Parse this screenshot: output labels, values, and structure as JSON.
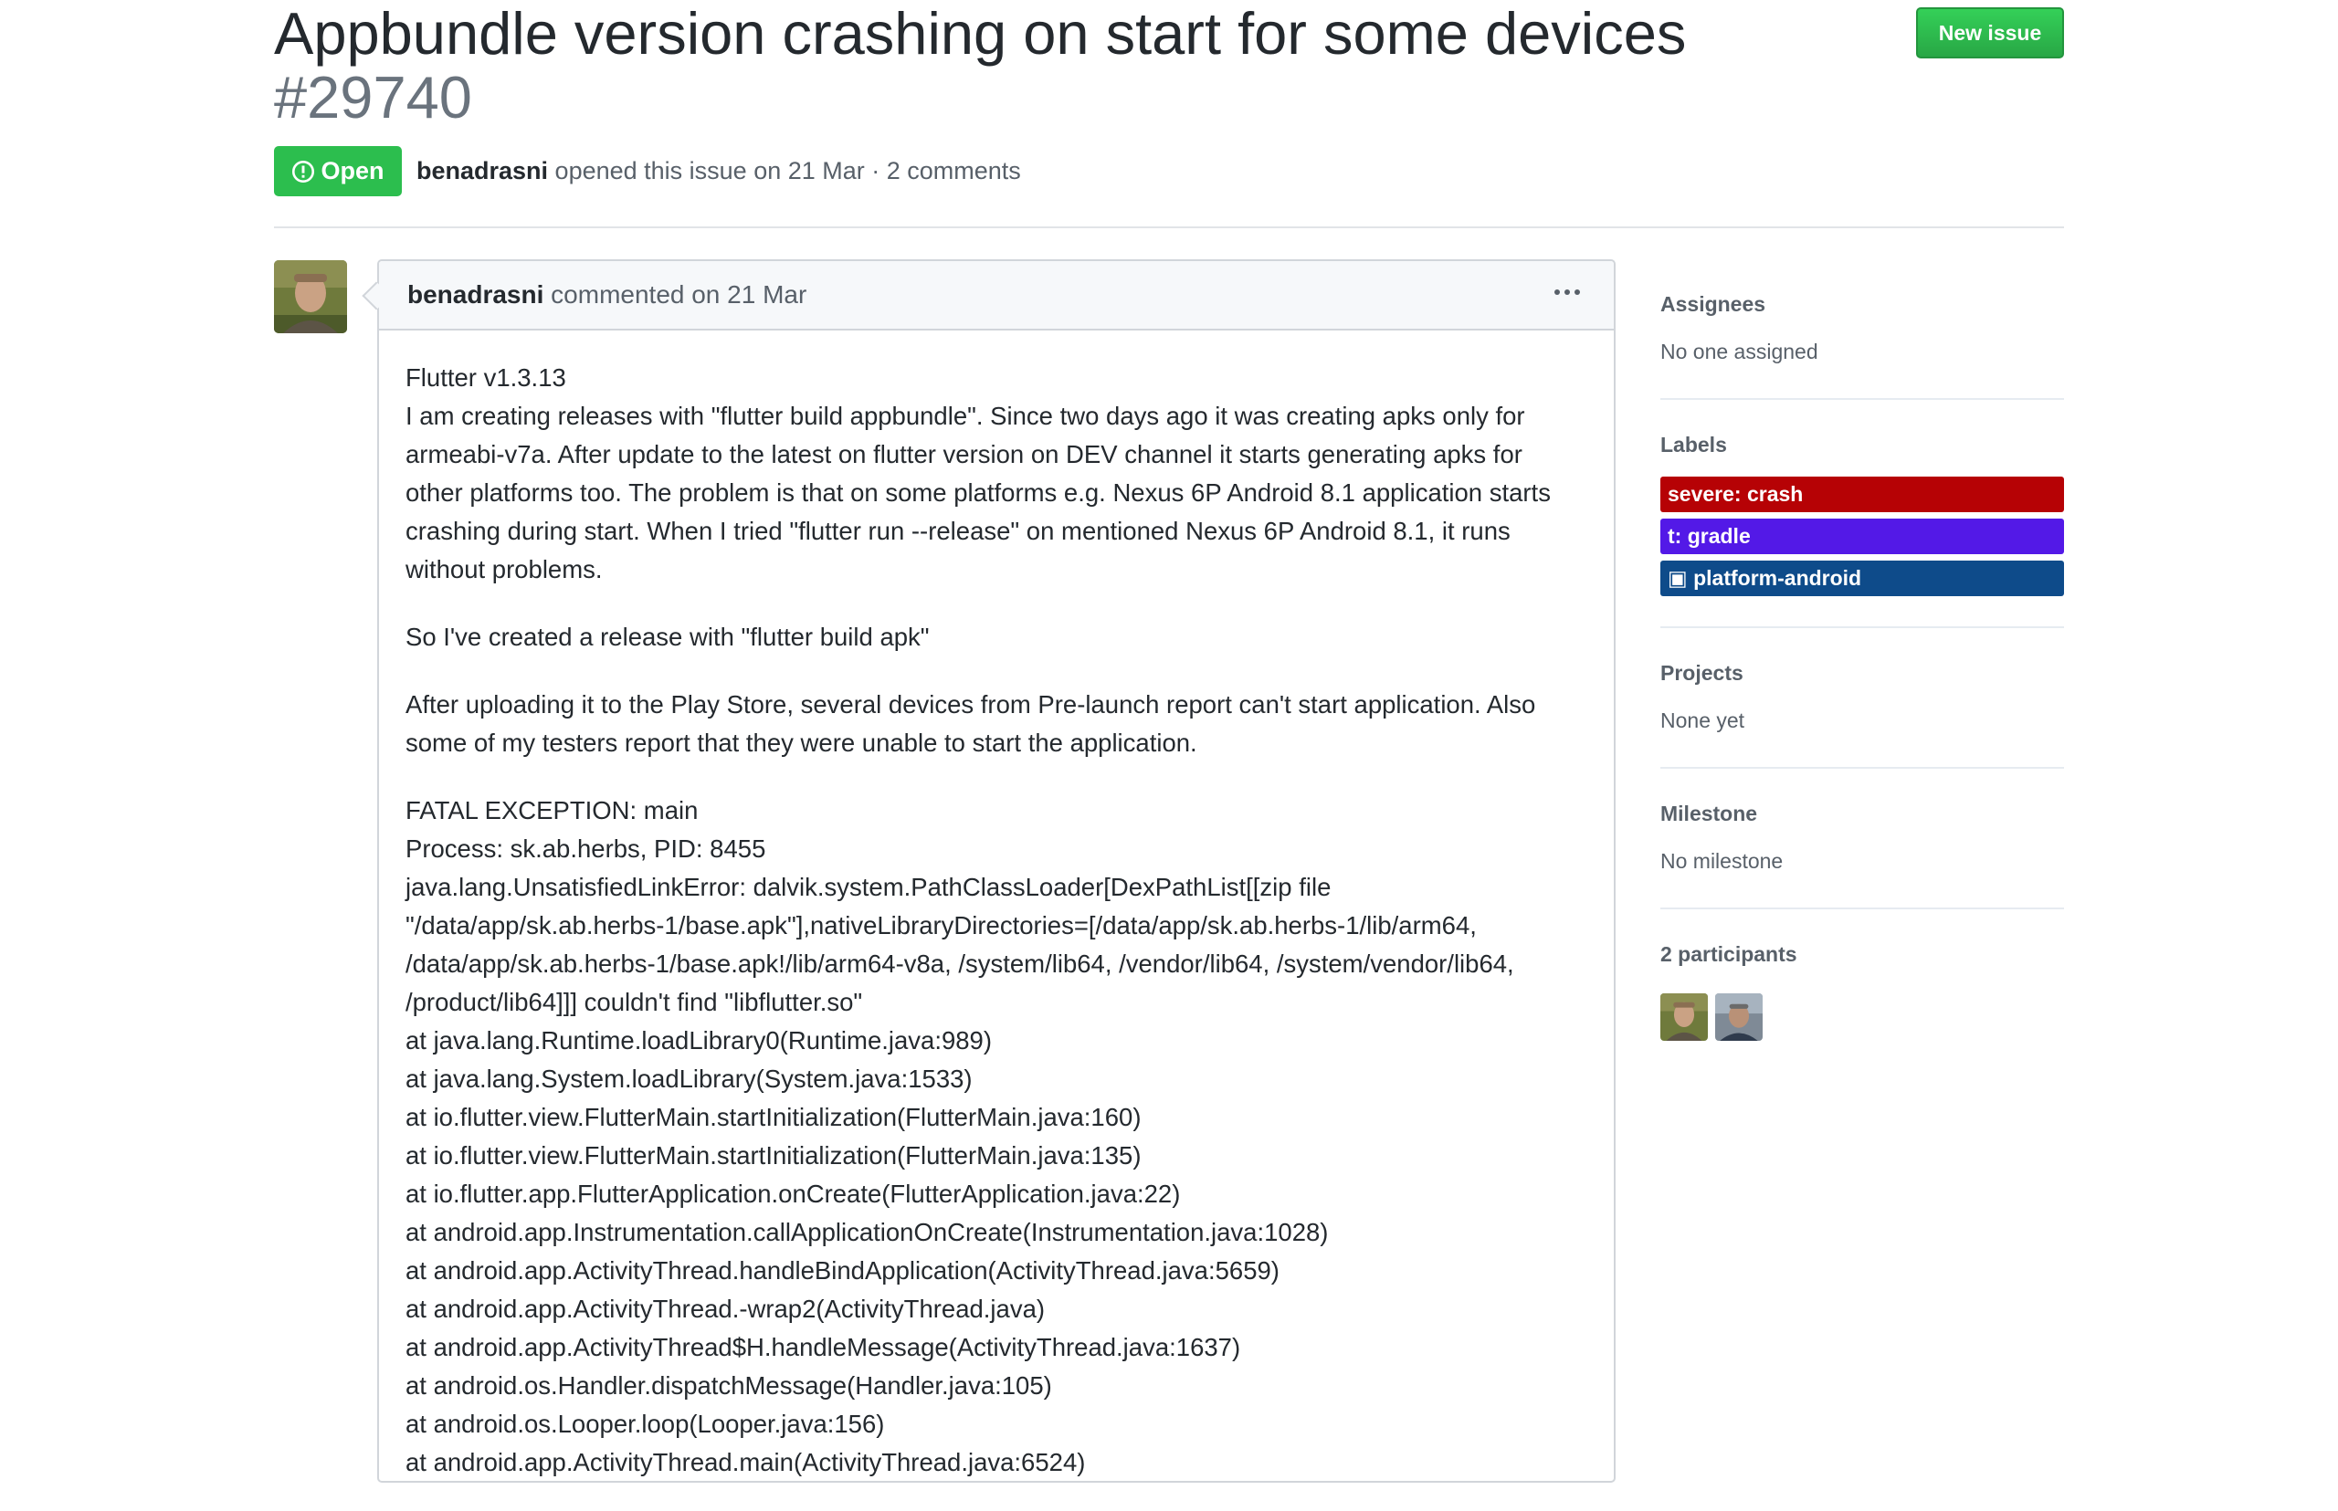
{
  "issue": {
    "title": "Appbundle version crashing on start for some devices",
    "number": "#29740",
    "state": "Open",
    "author": "benadrasni",
    "opened_text": " opened this issue on 21 Mar · 2 comments"
  },
  "header": {
    "new_issue_label": "New issue"
  },
  "colors": {
    "open_green": "#2cbe4e",
    "severe_crash": "#b60205",
    "t_gradle": "#5319e7",
    "platform_android": "#0e4b8a"
  },
  "comment": {
    "author": "benadrasni",
    "action": " commented on 21 Mar",
    "more_icon": "kebab-horizontal-icon",
    "paragraphs": [
      [
        "Flutter v1.3.13",
        "I am creating releases with \"flutter build appbundle\". Since two days ago it was creating apks only for",
        "armeabi-v7a. After update to the latest on flutter version on DEV channel it starts generating apks for",
        "other platforms too. The problem is that on some platforms e.g. Nexus 6P Android 8.1 application starts",
        "crashing during start. When I tried \"flutter run --release\" on mentioned Nexus 6P Android 8.1, it runs",
        "without problems."
      ],
      [
        "So I've created a release with \"flutter build apk\""
      ],
      [
        "After uploading it to the Play Store, several devices from Pre-launch report can't start application. Also",
        "some of my testers report that they were unable to start the application."
      ],
      [
        "FATAL EXCEPTION: main",
        "Process: sk.ab.herbs, PID: 8455",
        "java.lang.UnsatisfiedLinkError: dalvik.system.PathClassLoader[DexPathList[[zip file",
        "\"/data/app/sk.ab.herbs-1/base.apk\"],nativeLibraryDirectories=[/data/app/sk.ab.herbs-1/lib/arm64,",
        "/data/app/sk.ab.herbs-1/base.apk!/lib/arm64-v8a, /system/lib64, /vendor/lib64, /system/vendor/lib64,",
        "/product/lib64]]] couldn't find \"libflutter.so\"",
        "at java.lang.Runtime.loadLibrary0(Runtime.java:989)",
        "at java.lang.System.loadLibrary(System.java:1533)",
        "at io.flutter.view.FlutterMain.startInitialization(FlutterMain.java:160)",
        "at io.flutter.view.FlutterMain.startInitialization(FlutterMain.java:135)",
        "at io.flutter.app.FlutterApplication.onCreate(FlutterApplication.java:22)",
        "at android.app.Instrumentation.callApplicationOnCreate(Instrumentation.java:1028)",
        "at android.app.ActivityThread.handleBindApplication(ActivityThread.java:5659)",
        "at android.app.ActivityThread.-wrap2(ActivityThread.java)",
        "at android.app.ActivityThread$H.handleMessage(ActivityThread.java:1637)",
        "at android.os.Handler.dispatchMessage(Handler.java:105)",
        "at android.os.Looper.loop(Looper.java:156)",
        "at android.app.ActivityThread.main(ActivityThread.java:6524)"
      ]
    ]
  },
  "sidebar": {
    "assignees": {
      "heading": "Assignees",
      "value": "No one assigned"
    },
    "labels": {
      "heading": "Labels",
      "items": [
        {
          "text": "severe: crash"
        },
        {
          "text": "t: gradle"
        },
        {
          "text": "▣ platform-android"
        }
      ]
    },
    "projects": {
      "heading": "Projects",
      "value": "None yet"
    },
    "milestone": {
      "heading": "Milestone",
      "value": "No milestone"
    },
    "participants": {
      "heading": "2 participants"
    }
  }
}
